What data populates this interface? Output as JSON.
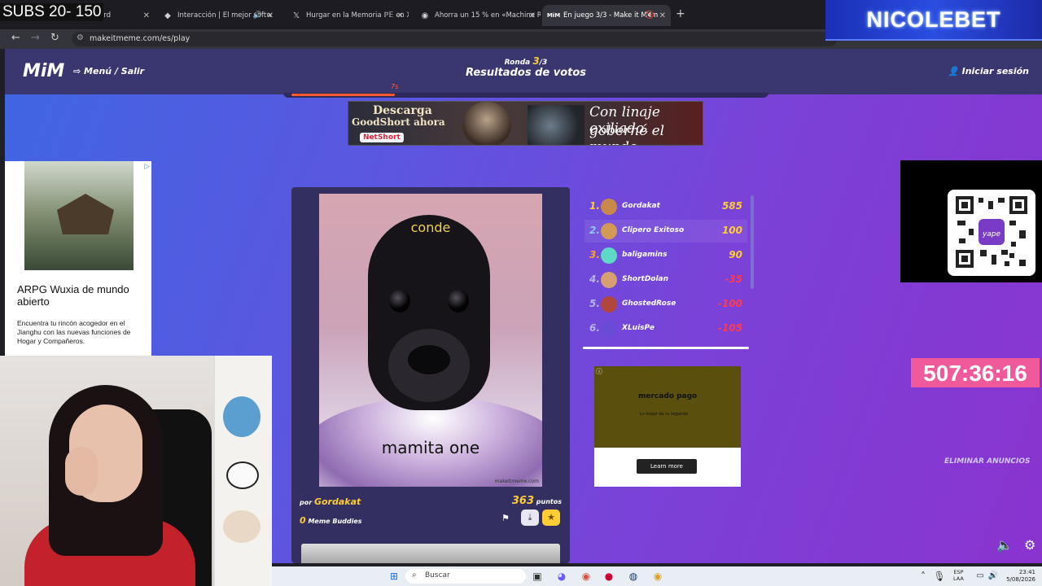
{
  "overlay": {
    "subs_text": "SUBS 20- 150",
    "channel_name": "NICOLEBET",
    "countdown": "507:36:16"
  },
  "browser": {
    "tabs": [
      {
        "label": "...nboard"
      },
      {
        "label": "Interacción | El mejor softw"
      },
      {
        "label": "Hurgar en la Memoria ℙ𝔼 en X"
      },
      {
        "label": "Ahorra un 15 % en «Machine R"
      },
      {
        "label": "En juego 3/3 - Make it Mem"
      }
    ],
    "url": "makeitmeme.com/es/play"
  },
  "game_header": {
    "logo": "MiM",
    "menu_label": "Menú / Salir",
    "round_prefix": "Ronda",
    "round_current": "3",
    "round_total": "/3",
    "title": "Resultados de votos",
    "login_label": "Iniciar sesión",
    "timer": "7s",
    "timer_progress": 0.22
  },
  "top_ad": {
    "line1": "Descarga",
    "line2": "GoodShort ahora",
    "brand": "NetShort",
    "tagline1": "Con linaje exiliado,",
    "tagline2": "goberné el mundo"
  },
  "left_ad": {
    "badge": "▷",
    "heading": "ARPG Wuxia de mundo abierto",
    "body": "Encuentra tu rincón acogedor en el Jianghu con las nuevas funciones de Hogar y Compañeros."
  },
  "meme": {
    "top_caption": "conde",
    "bottom_caption": "mamita one",
    "watermark": "makeitmeme.com",
    "author_prefix": "por",
    "author": "Gordakat",
    "points": "363",
    "points_label": "puntos",
    "buddies_count": "0",
    "buddies_label": "Meme Buddies"
  },
  "leaderboard": [
    {
      "rank": "1.",
      "name": "Gordakat",
      "score": "585",
      "rank_color": "#ffcc33",
      "score_color": "#ffcc33",
      "avatar": "#c9894a"
    },
    {
      "rank": "2.",
      "name": "Clipero Exitoso",
      "score": "100",
      "rank_color": "#8fc6ff",
      "score_color": "#ffcc33",
      "avatar": "#d29a55"
    },
    {
      "rank": "3.",
      "name": "baligamins",
      "score": "90",
      "rank_color": "#ff9f2e",
      "score_color": "#ffcc33",
      "avatar": "#5fd9c6"
    },
    {
      "rank": "4.",
      "name": "ShortDolan",
      "score": "-35",
      "rank_color": "#b8b3e6",
      "score_color": "#ff3b4f",
      "avatar": "#d8a070"
    },
    {
      "rank": "5.",
      "name": "GhostedRose",
      "score": "-100",
      "rank_color": "#b8b3e6",
      "score_color": "#ff3b4f",
      "avatar": "#b0473a"
    },
    {
      "rank": "6.",
      "name": "XLuisPe",
      "score": "-105",
      "rank_color": "#b8b3e6",
      "score_color": "#ff3b4f",
      "avatar": "#6a4bd8"
    }
  ],
  "side_ad": {
    "brand": "mercado pago",
    "tagline": "Lo mejor de tu llegando",
    "cta": "Learn more"
  },
  "right": {
    "remove_ads": "ELIMINAR ANUNCIOS",
    "qr_caption": "yape"
  },
  "taskbar": {
    "search_placeholder": "Buscar",
    "lang_line1": "ESP",
    "lang_line2": "LAA",
    "time": "23:41",
    "date": "5/08/2026"
  }
}
